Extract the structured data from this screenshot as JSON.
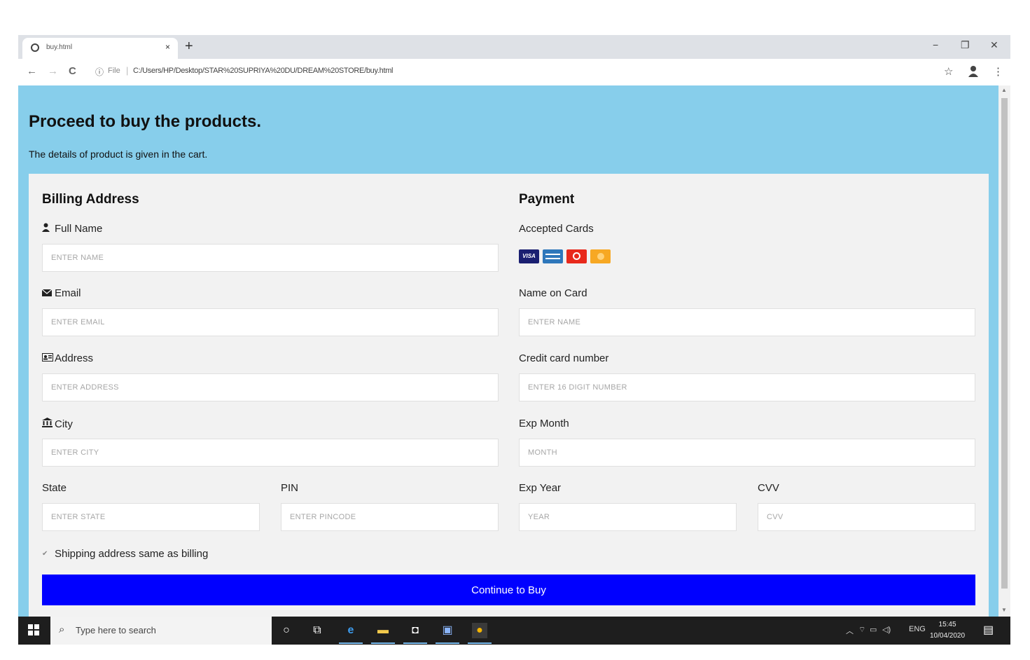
{
  "browser": {
    "tab_title": "buy.html",
    "tab_close": "×",
    "new_tab": "+",
    "win_minimize": "−",
    "win_restore": "❐",
    "win_close": "✕",
    "back": "←",
    "forward": "→",
    "reload": "C",
    "info": "ⓘ",
    "file_label": "File",
    "separator": "|",
    "url": "C:/Users/HP/Desktop/STAR%20SUPRIYA%20DU/DREAM%20STORE/buy.html",
    "star": "☆",
    "menu": "⋮"
  },
  "page": {
    "heading": "Proceed to buy the products.",
    "subheading": "The details of product is given in the cart."
  },
  "billing": {
    "title": "Billing Address",
    "fullname_label": "Full Name",
    "fullname_placeholder": "ENTER NAME",
    "email_label": "Email",
    "email_placeholder": "ENTER EMAIL",
    "address_label": "Address",
    "address_placeholder": "ENTER ADDRESS",
    "city_label": "City",
    "city_placeholder": "ENTER CITY",
    "state_label": "State",
    "state_placeholder": "ENTER STATE",
    "pin_label": "PIN",
    "pin_placeholder": "ENTER PINCODE"
  },
  "payment": {
    "title": "Payment",
    "accepted_label": "Accepted Cards",
    "visa_text": "VISA",
    "namecard_label": "Name on Card",
    "namecard_placeholder": "ENTER NAME",
    "ccnum_label": "Credit card number",
    "ccnum_placeholder": "ENTER 16 DIGIT NUMBER",
    "expmonth_label": "Exp Month",
    "expmonth_placeholder": "MONTH",
    "expyear_label": "Exp Year",
    "expyear_placeholder": "YEAR",
    "cvv_label": "CVV",
    "cvv_placeholder": "CVV"
  },
  "form": {
    "checkbox_label": "Shipping address same as billing",
    "checked": true,
    "submit_label": "Continue to Buy"
  },
  "taskbar": {
    "search_placeholder": "Type here to search",
    "language": "ENG",
    "time": "15:45",
    "date": "10/04/2020"
  },
  "colors": {
    "page_bg": "#87ceeb",
    "card_bg": "#f2f2f2",
    "button_bg": "#0000ff"
  }
}
